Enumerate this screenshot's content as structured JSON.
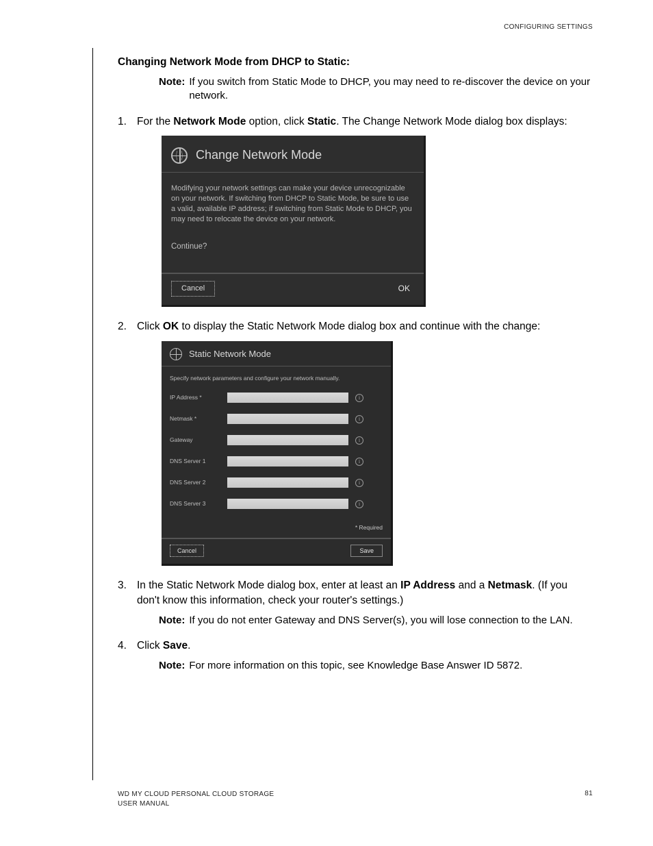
{
  "header": {
    "section": "CONFIGURING SETTINGS"
  },
  "title": "Changing Network Mode from DHCP to Static:",
  "note1": {
    "label": "Note:",
    "text": "If you switch from Static Mode to DHCP, you may need to re-discover the device on your network."
  },
  "step1": {
    "num": "1.",
    "pre": "For the ",
    "b1": "Network Mode",
    "mid": " option, click ",
    "b2": "Static",
    "post": ". The Change Network Mode dialog box displays:"
  },
  "dialog1": {
    "title": "Change Network Mode",
    "body": "Modifying your network settings can make your device unrecognizable on your network. If switching from DHCP to Static Mode, be sure to use a valid, available IP address; if switching from Static Mode to DHCP, you may need to relocate the device on your network.",
    "continue": "Continue?",
    "cancel": "Cancel",
    "ok": "OK"
  },
  "step2": {
    "num": "2.",
    "pre": "Click ",
    "b1": "OK",
    "post": " to display the Static Network Mode dialog box and continue with the change:"
  },
  "dialog2": {
    "title": "Static Network Mode",
    "subtitle": "Specify network parameters and configure your network manually.",
    "fields": {
      "ip": "IP Address *",
      "netmask": "Netmask *",
      "gateway": "Gateway",
      "dns1": "DNS Server 1",
      "dns2": "DNS Server 2",
      "dns3": "DNS Server 3"
    },
    "required": "* Required",
    "cancel": "Cancel",
    "save": "Save"
  },
  "step3": {
    "num": "3.",
    "pre": "In the Static Network Mode dialog box, enter at least an ",
    "b1": "IP Address",
    "mid": " and a ",
    "b2": "Netmask",
    "post": ". (If you don't know this information, check your router's settings.)"
  },
  "note2": {
    "label": "Note:",
    "text": "If you do not enter Gateway and DNS Server(s), you will lose connection to the LAN."
  },
  "step4": {
    "num": "4.",
    "pre": "Click ",
    "b1": "Save",
    "post": "."
  },
  "note3": {
    "label": "Note:",
    "text": "For more information on this topic, see Knowledge Base Answer ID 5872."
  },
  "footer": {
    "line1": "WD MY CLOUD PERSONAL CLOUD STORAGE",
    "line2": "USER MANUAL",
    "page": "81"
  }
}
